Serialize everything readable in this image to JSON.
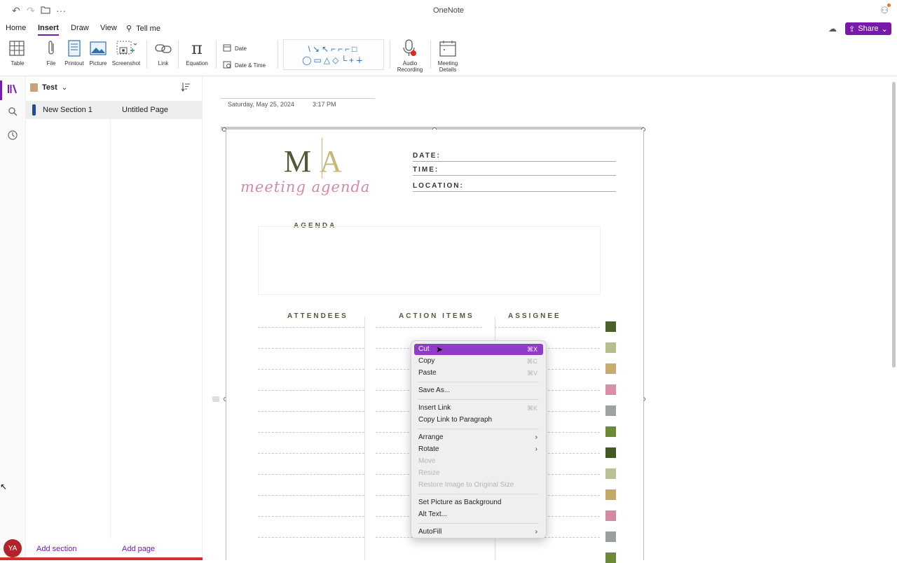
{
  "app": {
    "title": "OneNote"
  },
  "menu": {
    "tabs": [
      "Home",
      "Insert",
      "Draw",
      "View"
    ],
    "active": "Insert",
    "tell_me": "Tell me",
    "share": "Share"
  },
  "ribbon": {
    "table": "Table",
    "file": "File",
    "printout": "Printout",
    "picture": "Picture",
    "screenshot": "Screenshot",
    "link": "Link",
    "equation": "Equation",
    "date": "Date",
    "date_time": "Date & Time",
    "audio": [
      "Audio",
      "Recording"
    ],
    "meeting": [
      "Meeting",
      "Details"
    ],
    "shapes_row1": "\\↘↖⌐⌐⌐□",
    "shapes_row2": "◯▭△◇└+∔"
  },
  "sidebar": {
    "notebook": "Test",
    "section": "New Section 1",
    "page": "Untitled Page",
    "add_section": "Add section",
    "add_page": "Add page",
    "avatar": "YA"
  },
  "page": {
    "date": "Saturday, May 25, 2024",
    "time": "3:17 PM"
  },
  "image": {
    "logo_m": "M",
    "logo_a": "A",
    "script": "meeting agenda",
    "fields": [
      "DATE:",
      "TIME:",
      "LOCATION:"
    ],
    "agenda": "AGENDA",
    "columns": [
      "ATTENDEES",
      "ACTION ITEMS",
      "ASSIGNEE"
    ],
    "swatch_colors": [
      "#4b6127",
      "#b5bf8a",
      "#c8ad6a",
      "#d990a6",
      "#9da3a0",
      "#6b8a32",
      "#3f5a22",
      "#b8c292",
      "#c4a866",
      "#d48aa6",
      "#9aa09d",
      "#6a8a34"
    ]
  },
  "context_menu": {
    "items": [
      {
        "label": "Cut",
        "shortcut": "⌘X",
        "state": "highlighted"
      },
      {
        "label": "Copy",
        "shortcut": "⌘C"
      },
      {
        "label": "Paste",
        "shortcut": "⌘V"
      },
      {
        "sep": true
      },
      {
        "label": "Save As..."
      },
      {
        "sep": true
      },
      {
        "label": "Insert Link",
        "shortcut": "⌘K"
      },
      {
        "label": "Copy Link to Paragraph"
      },
      {
        "sep": true
      },
      {
        "label": "Arrange",
        "submenu": true
      },
      {
        "label": "Rotate",
        "submenu": true
      },
      {
        "label": "Move",
        "state": "disabled"
      },
      {
        "label": "Resize",
        "state": "disabled"
      },
      {
        "label": "Restore Image to Original Size",
        "state": "disabled"
      },
      {
        "sep": true
      },
      {
        "label": "Set Picture as Background"
      },
      {
        "label": "Alt Text..."
      },
      {
        "sep": true
      },
      {
        "label": "AutoFill",
        "submenu": true
      }
    ]
  },
  "colors": {
    "accent": "#7719aa",
    "highlight": "#8f3cc8"
  }
}
